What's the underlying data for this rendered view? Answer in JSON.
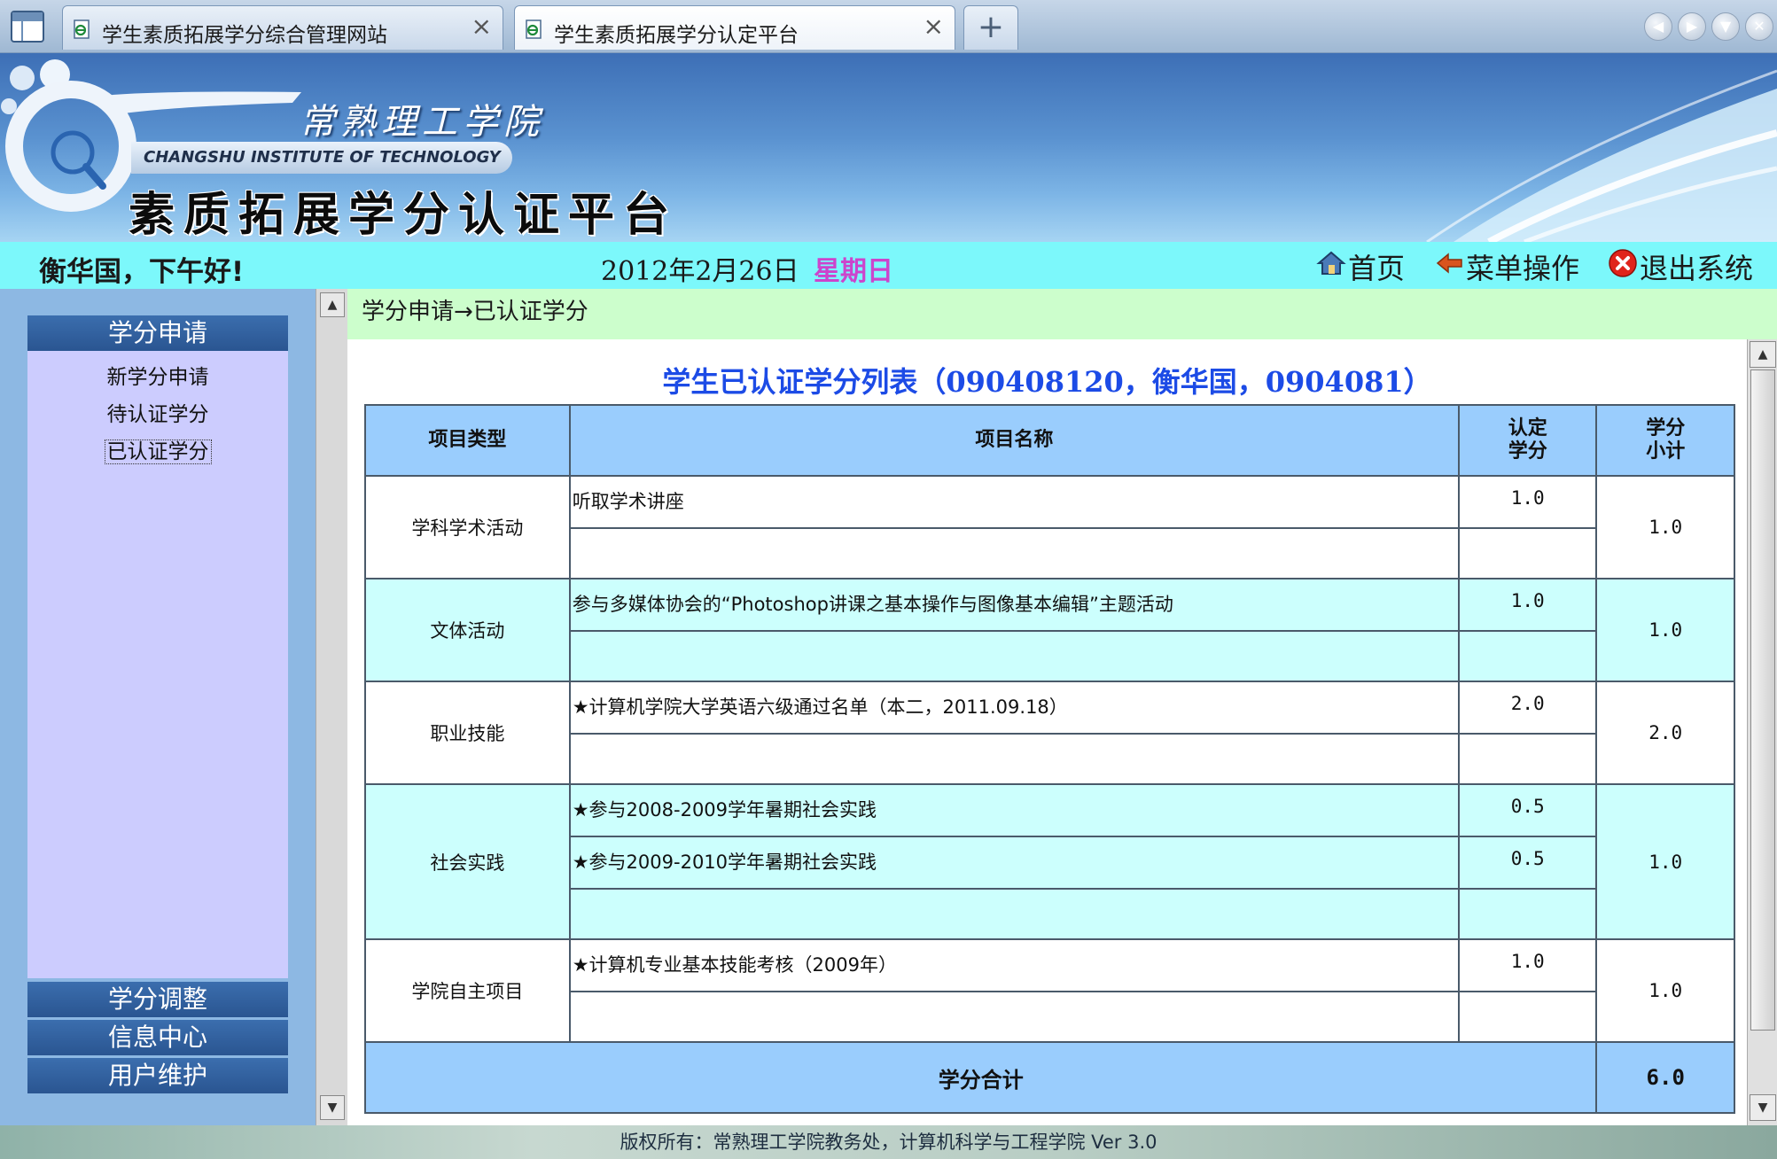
{
  "browser": {
    "tabs": [
      {
        "label": "学生素质拓展学分综合管理网站",
        "active": false
      },
      {
        "label": "学生素质拓展学分认定平台",
        "active": true
      }
    ],
    "new_tab": "+"
  },
  "banner": {
    "school_cn": "常熟理工学院",
    "school_en": "CHANGSHU INSTITUTE OF TECHNOLOGY",
    "platform": "素质拓展学分认证平台"
  },
  "infobar": {
    "greeting": "衡华国，下午好!",
    "date": "2012年2月26日",
    "weekday": "星期日",
    "nav": {
      "home": "首页",
      "menu": "菜单操作",
      "logout": "退出系统"
    }
  },
  "sidebar": {
    "credit_apply": "学分申请",
    "items": [
      "新学分申请",
      "待认证学分",
      "已认证学分"
    ],
    "current_item": "已认证学分",
    "credit_adjust": "学分调整",
    "info_center": "信息中心",
    "user_maint": "用户维护"
  },
  "main": {
    "breadcrumb": "学分申请→已认证学分",
    "title": "学生已认证学分列表（090408120，衡华国，0904081）",
    "headers": {
      "type": "项目类型",
      "name": "项目名称",
      "credit": "认定学分",
      "subtotal": "学分小计"
    },
    "groups": [
      {
        "type": "学科学术活动",
        "items": [
          {
            "name": "听取学术讲座",
            "credit": "1.0"
          }
        ],
        "subtotal": "1.0"
      },
      {
        "type": "文体活动",
        "items": [
          {
            "name": "参与多媒体协会的“Photoshop讲课之基本操作与图像基本编辑”主题活动",
            "credit": "1.0"
          }
        ],
        "subtotal": "1.0"
      },
      {
        "type": "职业技能",
        "items": [
          {
            "name": "★计算机学院大学英语六级通过名单（本二，2011.09.18）",
            "credit": "2.0"
          }
        ],
        "subtotal": "2.0"
      },
      {
        "type": "社会实践",
        "items": [
          {
            "name": "★参与2008-2009学年暑期社会实践",
            "credit": "0.5"
          },
          {
            "name": "★参与2009-2010学年暑期社会实践",
            "credit": "0.5"
          }
        ],
        "subtotal": "1.0"
      },
      {
        "type": "学院自主项目",
        "items": [
          {
            "name": "★计算机专业基本技能考核（2009年）",
            "credit": "1.0"
          }
        ],
        "subtotal": "1.0"
      }
    ],
    "total_label": "学分合计",
    "total_value": "6.0"
  },
  "footer": "版权所有：常熟理工学院教务处，计算机科学与工程学院 Ver 3.0",
  "colors": {
    "infobar_bg": "#7cf8fb",
    "breadcrumb_bg": "#ccfecc",
    "table_header_bg": "#9acdfd",
    "alt_row_bg": "#ccfffd",
    "menu_head_bg": "#2f5e9c",
    "menu_panel_bg": "#ccccfe",
    "title_color": "#1c4be6",
    "weekday_color": "#cc44cc"
  },
  "icons": {
    "tab": "ie-page-icon",
    "home": "home-house-icon",
    "menu": "back-arrow-icon",
    "logout": "red-close-icon"
  }
}
